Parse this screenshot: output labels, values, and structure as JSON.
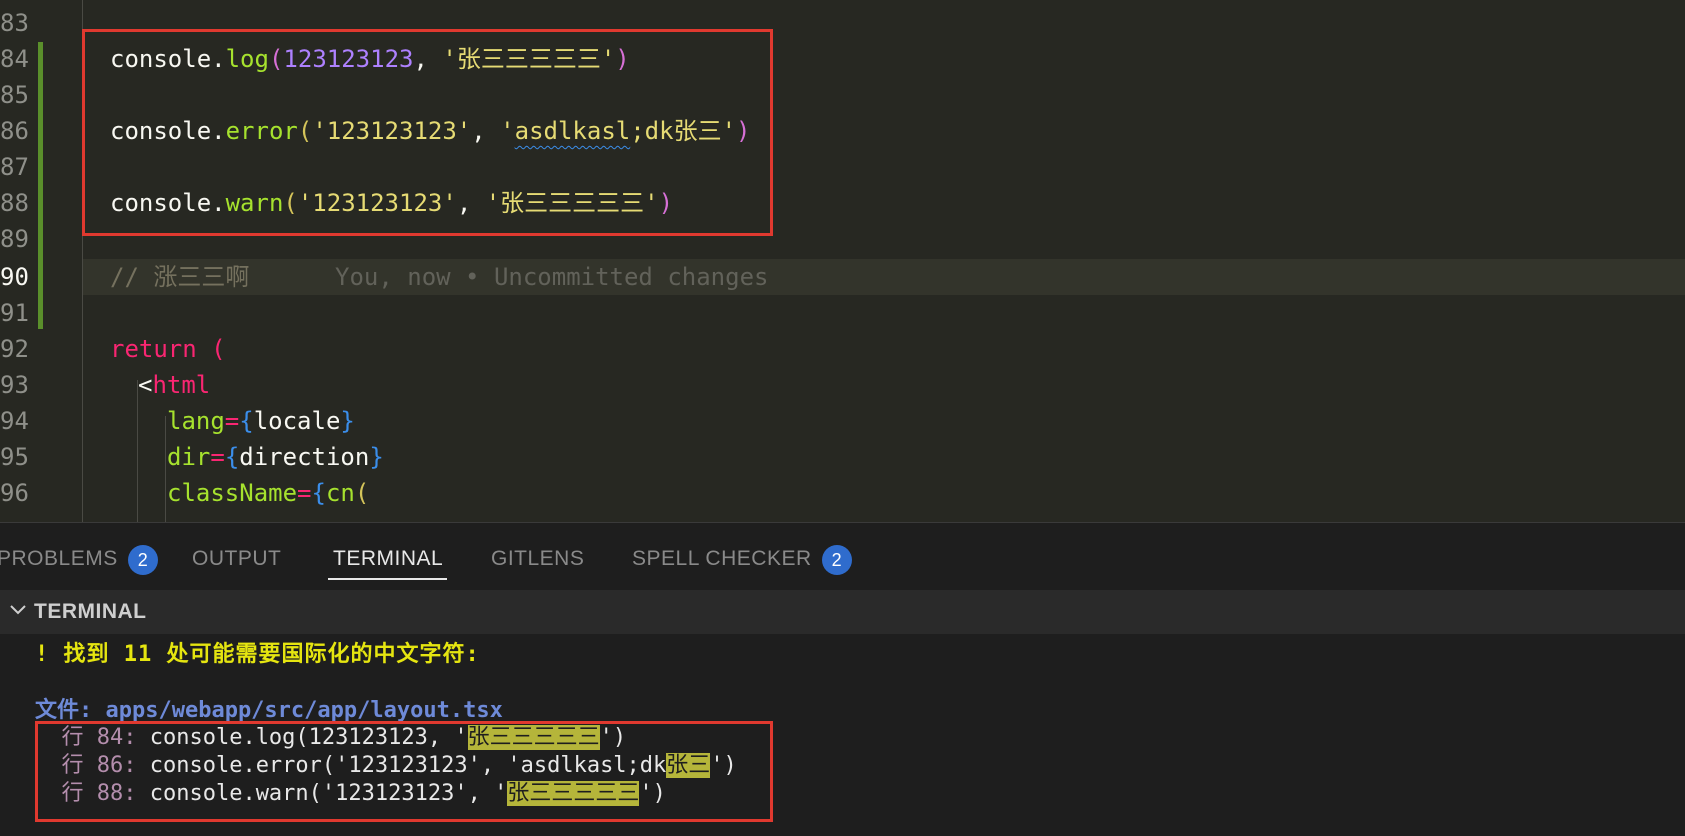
{
  "editor": {
    "line_numbers": [
      "83",
      "84",
      "85",
      "86",
      "87",
      "88",
      "89",
      "90",
      "91",
      "92",
      "93",
      "94",
      "95",
      "96"
    ],
    "line84": {
      "obj": "console",
      "dot": ".",
      "fn": "log",
      "open": "(",
      "num": "123123123",
      "sep": ", ",
      "str": "'张三三三三三'",
      "close": ")"
    },
    "line86": {
      "obj": "console",
      "dot": ".",
      "fn": "error",
      "open": "(",
      "str1": "'123123123'",
      "sep": ", ",
      "q": "'",
      "squiggle": "asdlkasl",
      "str2rest": ";dk张三'",
      "close": ")"
    },
    "line88": {
      "obj": "console",
      "dot": ".",
      "fn": "warn",
      "open": "(",
      "str1": "'123123123'",
      "sep": ", ",
      "str2": "'张三三三三三'",
      "close": ")"
    },
    "line90": {
      "comment": "// 涨三三啊",
      "blame": "You, now • Uncommitted changes"
    },
    "line92": {
      "kw": "return",
      "paren": "("
    },
    "line93": {
      "lt": "<",
      "tag": "html"
    },
    "line94": {
      "attr": "lang",
      "eq": "=",
      "ob": "{",
      "val": "locale",
      "cb": "}"
    },
    "line95": {
      "attr": "dir",
      "eq": "=",
      "ob": "{",
      "val": "direction",
      "cb": "}"
    },
    "line96": {
      "attr": "className",
      "eq": "=",
      "ob": "{",
      "fn": "cn",
      "paren": "("
    }
  },
  "panel": {
    "tabs": [
      {
        "label": "PROBLEMS",
        "badge": "2"
      },
      {
        "label": "OUTPUT"
      },
      {
        "label": "TERMINAL"
      },
      {
        "label": "GITLENS"
      },
      {
        "label": "SPELL CHECKER",
        "badge": "2"
      }
    ],
    "terminal_title": "TERMINAL"
  },
  "terminal": {
    "warning": "! 找到 11 处可能需要国际化的中文字符:",
    "file_label": "文件: apps/webapp/src/app/layout.tsx",
    "rows": [
      {
        "label": "行 84:",
        "pre": " console.log(123123123, '",
        "hl": "张三三三三三",
        "post": "')"
      },
      {
        "label": "行 86:",
        "pre": " console.error('123123123', 'asdlkasl;dk",
        "hl": "张三",
        "post": "')"
      },
      {
        "label": "行 88:",
        "pre": " console.warn('123123123', '",
        "hl": "张三三三三三",
        "post": "')"
      }
    ]
  }
}
